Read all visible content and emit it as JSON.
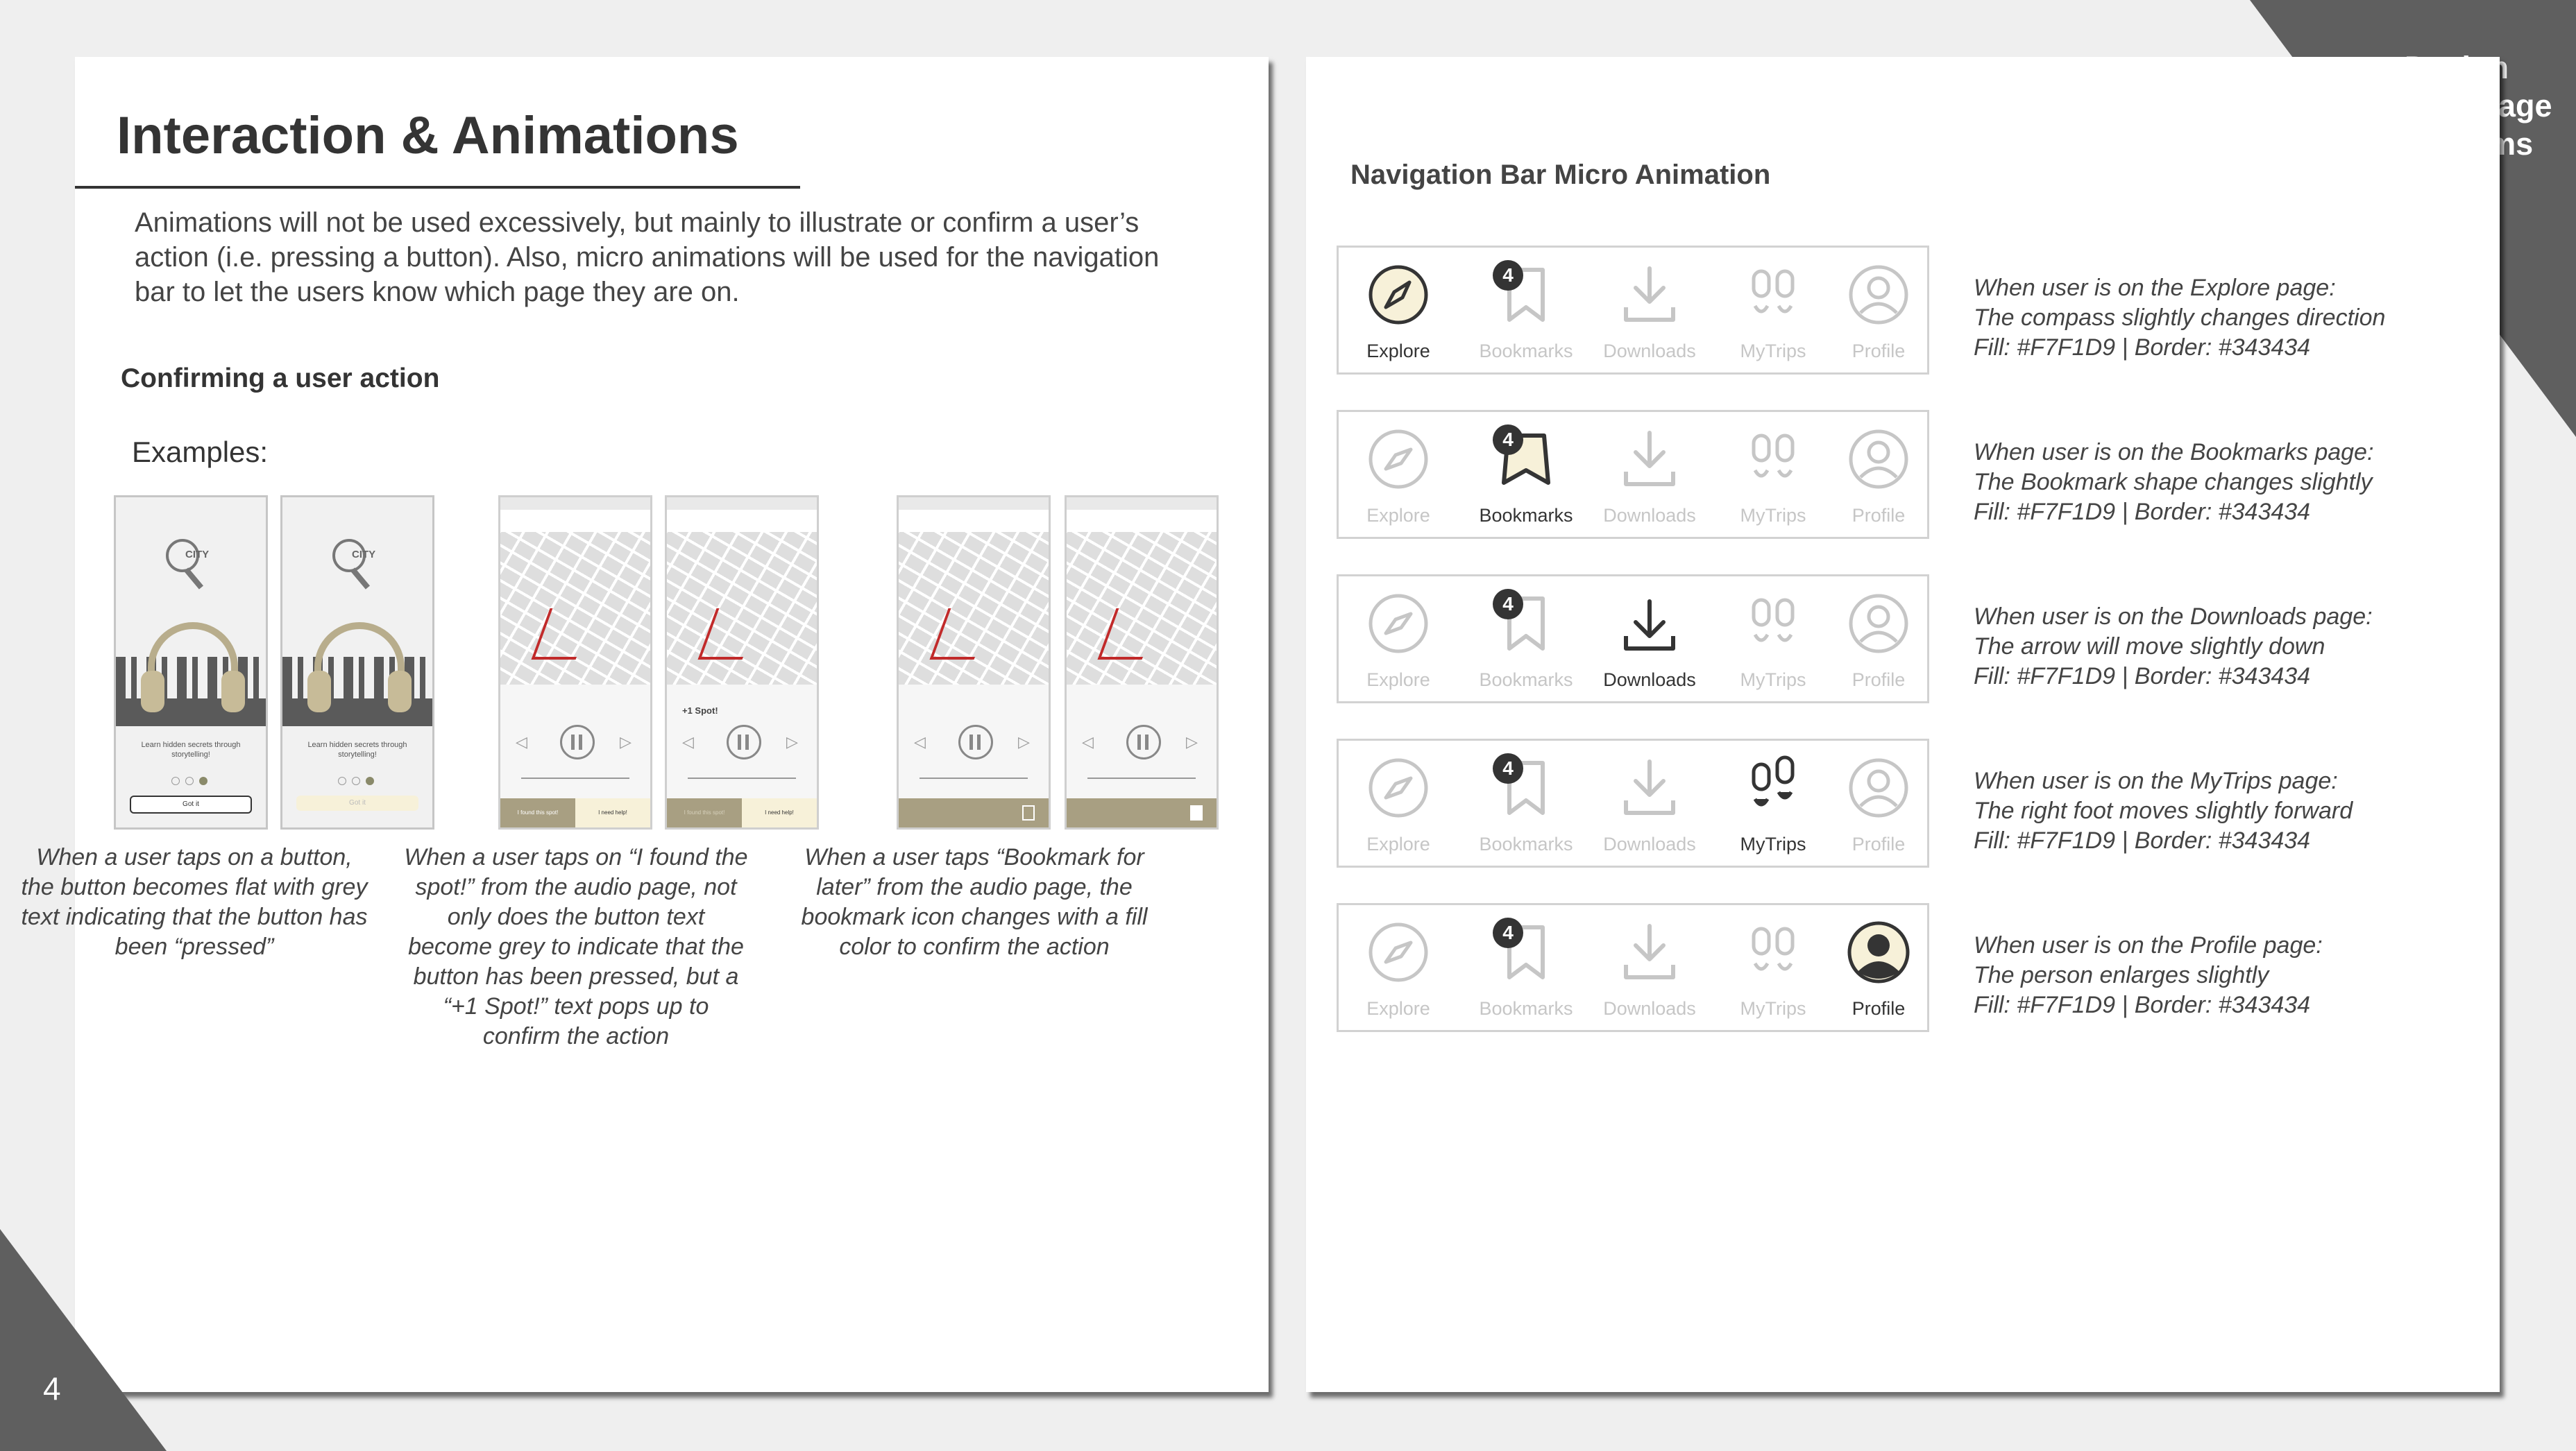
{
  "brand": {
    "label_lines": [
      "Design",
      "Language",
      "Systems"
    ]
  },
  "page_number": "4",
  "left": {
    "title": "Interaction & Animations",
    "intro": "Animations will not be used excessively, but mainly to illustrate or confirm a user’s action (i.e. pressing a button). Also, micro animations will be used for the navigation bar to let the users know which page they are on.",
    "section_heading": "Confirming a user action",
    "examples_label": "Examples:",
    "phones": {
      "onboarding_text": "Learn hidden secrets through storytelling!",
      "logo_text": "CITY",
      "cta": "Got it",
      "spot_pop": "+1 Spot!",
      "found_button": "I found this spot!",
      "help_button": "I need help!"
    },
    "captions": [
      "When a user taps on a button, the button becomes flat with grey text indicating that the button has been “pressed”",
      "When a user taps on “I found the spot!” from the audio page, not only does the button text become grey to indicate that the button has been pressed, but a “+1 Spot!” text pops up to confirm the action",
      "When a user taps “Bookmark for later” from the audio page, the bookmark icon changes with a fill color to confirm the action"
    ]
  },
  "right": {
    "title": "Navigation Bar Micro Animation",
    "nav_labels": [
      "Explore",
      "Bookmarks",
      "Downloads",
      "MyTrips",
      "Profile"
    ],
    "badge_count": "4",
    "rows": [
      {
        "active": "Explore",
        "desc": [
          "When user is on the Explore page:",
          "The compass slightly changes direction",
          "Fill: #F7F1D9 | Border: #343434"
        ]
      },
      {
        "active": "Bookmarks",
        "desc": [
          "When user is on the Bookmarks page:",
          "The Bookmark shape changes slightly",
          "Fill: #F7F1D9 | Border: #343434"
        ]
      },
      {
        "active": "Downloads",
        "desc": [
          "When user is on the Downloads page:",
          "The arrow will move slightly down",
          "Fill: #F7F1D9 | Border: #343434"
        ]
      },
      {
        "active": "MyTrips",
        "desc": [
          "When user is on the MyTrips page:",
          "The right foot moves slightly forward",
          "Fill: #F7F1D9 | Border: #343434"
        ]
      },
      {
        "active": "Profile",
        "desc": [
          "When user is on the Profile page:",
          "The person enlarges slightly",
          "Fill: #F7F1D9 | Border: #343434"
        ]
      }
    ]
  },
  "colors": {
    "fill": "#F7F1D9",
    "border": "#343434",
    "inactive": "#C6C6C6",
    "corner": "#5F5F5F"
  },
  "icons": [
    "compass-icon",
    "bookmark-icon",
    "download-icon",
    "footprints-icon",
    "person-icon"
  ]
}
